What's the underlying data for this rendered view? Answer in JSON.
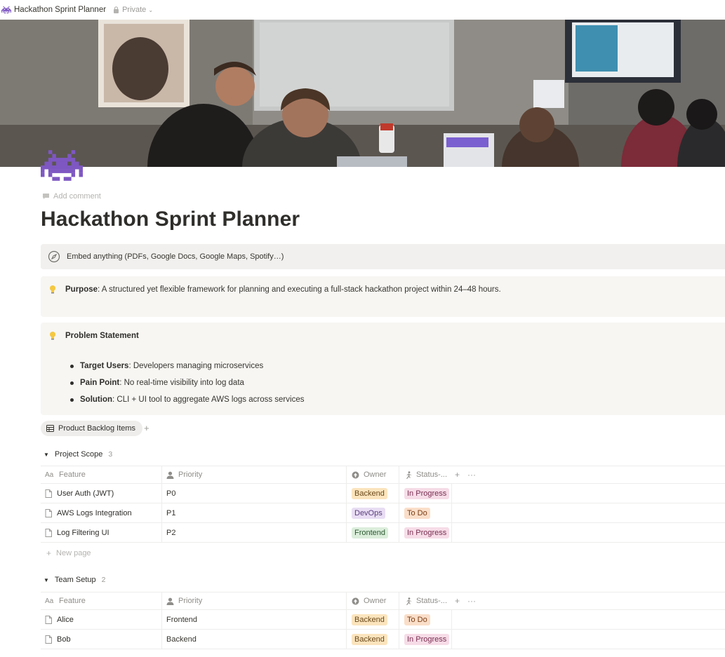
{
  "topbar": {
    "title": "Hackathon Sprint Planner",
    "privacy": "Private"
  },
  "page": {
    "add_comment": "Add comment",
    "title": "Hackathon Sprint Planner",
    "embed_text": "Embed anything (PDFs, Google Docs, Google Maps, Spotify…)"
  },
  "callout_purpose": {
    "label": "Purpose",
    "text": ": A structured yet flexible framework for planning and executing a full-stack hackathon project within 24–48 hours."
  },
  "callout_problem": {
    "title": "Problem Statement",
    "bullets": [
      {
        "label": "Target Users",
        "text": ": Developers managing microservices"
      },
      {
        "label": "Pain Point",
        "text": ": No real-time visibility into log data"
      },
      {
        "label": "Solution",
        "text": ": CLI + UI tool to aggregate AWS logs across services"
      }
    ]
  },
  "database": {
    "view_label": "Product Backlog Items",
    "add_view": "+",
    "columns": {
      "feature": "Feature",
      "priority": "Priority",
      "owner": "Owner",
      "status": "Status-..."
    },
    "new_page": "New page",
    "groups": [
      {
        "name": "Project Scope",
        "count": "3",
        "rows": [
          {
            "feature": "User Auth (JWT)",
            "priority": "P0",
            "owner": "Backend",
            "status": "In Progress"
          },
          {
            "feature": "AWS Logs Integration",
            "priority": "P1",
            "owner": "DevOps",
            "status": "To Do"
          },
          {
            "feature": "Log Filtering UI",
            "priority": "P2",
            "owner": "Frontend",
            "status": "In Progress"
          }
        ]
      },
      {
        "name": "Team Setup",
        "count": "2",
        "rows": [
          {
            "feature": "Alice",
            "priority": "Frontend",
            "owner": "Backend",
            "status": "To Do"
          },
          {
            "feature": "Bob",
            "priority": "Backend",
            "owner": "Backend",
            "status": "In Progress"
          }
        ]
      }
    ]
  },
  "colors": {
    "backend_bg": "#fbe4bd",
    "backend_fg": "#6b4a1c",
    "devops_bg": "#e8ddf3",
    "devops_fg": "#5a3f7d",
    "frontend_bg": "#dbeddb",
    "frontend_fg": "#2b5930",
    "inprogress_bg": "#f6dce7",
    "inprogress_fg": "#7a2f52",
    "todo_bg": "#fadec9",
    "todo_fg": "#7a3d14"
  }
}
